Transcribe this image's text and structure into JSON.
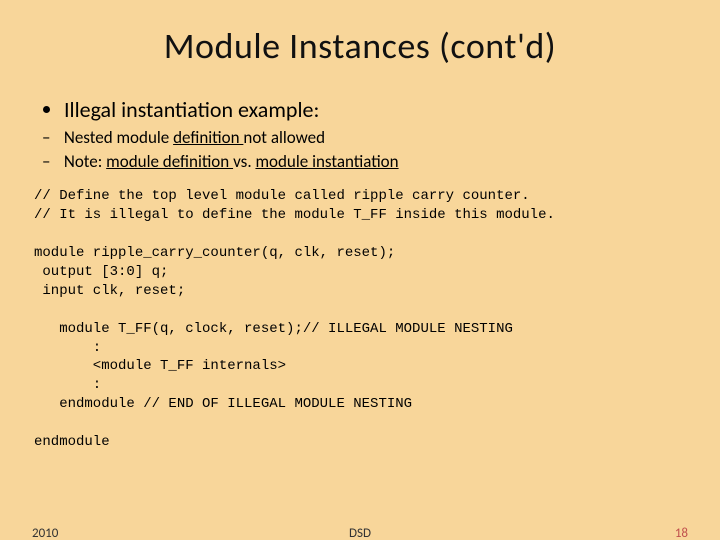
{
  "title": "Module Instances (cont'd)",
  "bullet1": "Illegal instantiation example:",
  "sub1_pre": "Nested module ",
  "sub1_u": "definition ",
  "sub1_post": "not allowed",
  "sub2_pre": "Note: ",
  "sub2_u1": "module definition ",
  "sub2_mid": "vs. ",
  "sub2_u2": "module instantiation",
  "code": "// Define the top level module called ripple carry counter.\n// It is illegal to define the module T_FF inside this module.\n\nmodule ripple_carry_counter(q, clk, reset);\n output [3:0] q;\n input clk, reset;\n\n   module T_FF(q, clock, reset);// ILLEGAL MODULE NESTING\n       :\n       <module T_FF internals>\n       :\n   endmodule // END OF ILLEGAL MODULE NESTING\n\nendmodule",
  "footer": {
    "year": "2010",
    "mid": "DSD",
    "num": "18"
  }
}
